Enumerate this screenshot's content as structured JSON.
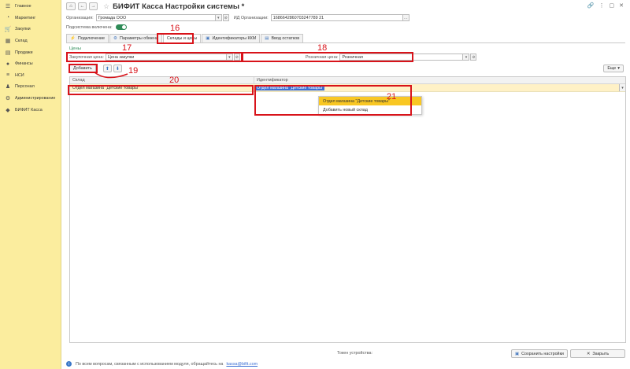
{
  "sidebar": {
    "items": [
      {
        "label": "Главное",
        "icon": "menu-icon"
      },
      {
        "label": "Маркетинг",
        "icon": "marketing-icon"
      },
      {
        "label": "Закупки",
        "icon": "cart-icon"
      },
      {
        "label": "Склад",
        "icon": "warehouse-icon"
      },
      {
        "label": "Продажи",
        "icon": "sales-icon"
      },
      {
        "label": "Финансы",
        "icon": "finance-icon"
      },
      {
        "label": "НСИ",
        "icon": "reference-icon"
      },
      {
        "label": "Персонал",
        "icon": "person-icon"
      },
      {
        "label": "Администрирование",
        "icon": "gear-icon"
      },
      {
        "label": "БИФИТ Касса",
        "icon": "bifit-icon"
      }
    ]
  },
  "window": {
    "title": "БИФИТ Касса Настройки системы *"
  },
  "org": {
    "label": "Организация:",
    "value": "Громада ООО",
    "id_label": "ИД Организации:",
    "id_value": "1686642860703247789 21"
  },
  "subsystem": {
    "label": "Подсистема включена:"
  },
  "tabs": [
    {
      "label": "Подключение"
    },
    {
      "label": "Параметры обмена"
    },
    {
      "label": "Склады и цены"
    },
    {
      "label": "Идентификаторы ККМ"
    },
    {
      "label": "Ввод остатков"
    }
  ],
  "prices": {
    "section_title": "Цены",
    "purchase_label": "Закупочная цена:",
    "purchase_value": "Цена закупки",
    "retail_label": "Розничная цена:",
    "retail_value": "Розничная"
  },
  "toolbar": {
    "add_label": "Добавить",
    "more_label": "Еще"
  },
  "table": {
    "columns": [
      "Склад",
      "Идентификатор"
    ],
    "rows": [
      {
        "warehouse": "Отдел магазина \"Детские товары\"",
        "identifier": "Отдел магазина \"Детские товары\""
      }
    ]
  },
  "dropdown": {
    "items": [
      "Отдел магазина \"Детские товары\"",
      "Добавить новый склад"
    ]
  },
  "annotations": [
    "16",
    "17",
    "18",
    "19",
    "20",
    "21"
  ],
  "footer": {
    "token_label": "Токен устройства:",
    "save_label": "Сохранить настройки",
    "close_label": "Закрыть",
    "info_text": "По всем вопросам, связанным с использованием модуля, обращайтесь на",
    "email": "kassa@bifit.com"
  },
  "colors": {
    "sidebar_bg": "#fbed9e",
    "annotation": "#d8131a",
    "highlight": "#f9c723",
    "row_bg": "#fff1c6",
    "section_green": "#2e8b57"
  }
}
